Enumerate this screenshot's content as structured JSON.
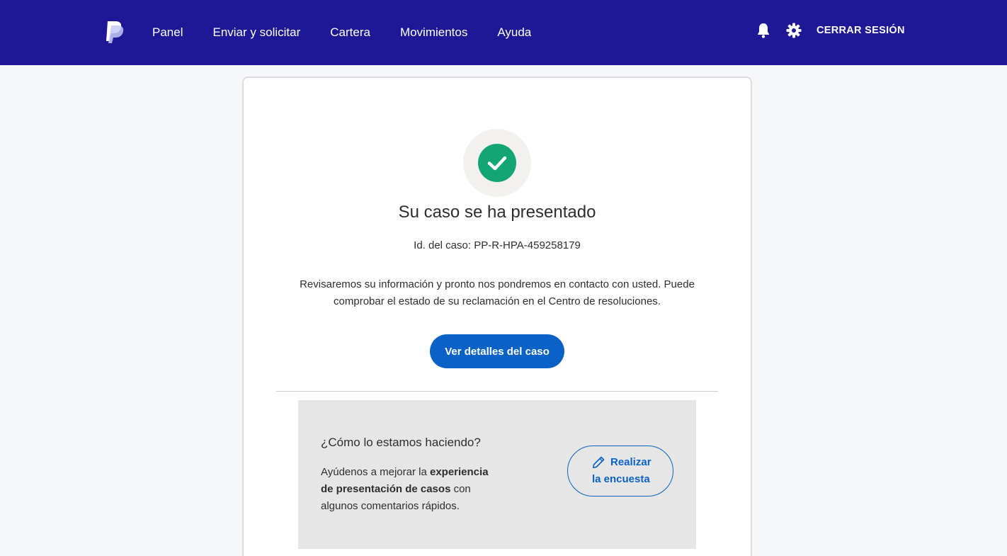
{
  "header": {
    "logo": "paypal-logo",
    "nav": [
      "Panel",
      "Enviar y solicitar",
      "Cartera",
      "Movimientos",
      "Ayuda"
    ],
    "logout_label": "CERRAR SESIÓN",
    "icons": [
      "bell-icon",
      "gear-icon"
    ]
  },
  "confirmation": {
    "title": "Su caso se ha presentado",
    "case_id": "Id. del caso: PP-R-HPA-459258179",
    "description": "Revisaremos su información y pronto nos pondremos en contacto con usted. Puede comprobar el estado de su reclamación en el Centro de resoluciones.",
    "button_label": "Ver detalles del caso",
    "status_icon": "check-icon"
  },
  "survey": {
    "title": "¿Cómo lo estamos haciendo?",
    "text_before": "Ayúdenos a mejorar la ",
    "text_bold": "experiencia de presentación de casos",
    "text_after": " con algunos comentarios rápidos.",
    "button_line1": "Realizar",
    "button_line2": "la encuesta"
  },
  "colors": {
    "header_bg": "#1e1896",
    "primary": "#0a61c6",
    "success": "#13a574"
  }
}
